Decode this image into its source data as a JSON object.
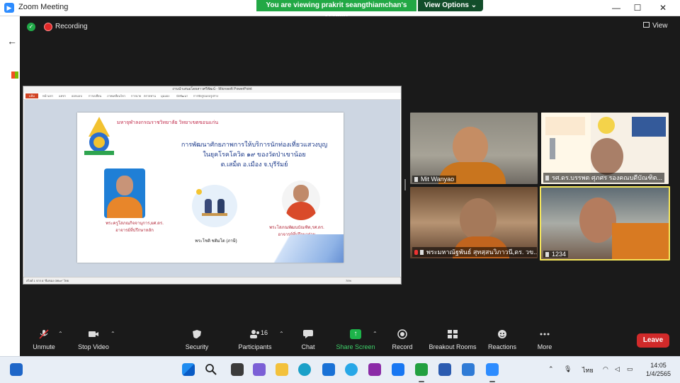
{
  "window": {
    "title": "Zoom Meeting",
    "minimize": "—",
    "maximize": "☐",
    "close": "✕"
  },
  "share_banner": {
    "text": "You are viewing prakrit seangthiamchan's screen",
    "view_options": "View Options ⌄"
  },
  "meeting": {
    "recording_label": "Recording",
    "view_label": "View"
  },
  "ppt": {
    "window_title": "งานนำเสนอโดยสาวศรีพัฒน์ - Microsoft PowerPoint",
    "file_tab": "แฟ้ม",
    "ribbon_tabs": [
      "หน้าแรก",
      "แทรก",
      "ออกแบบ",
      "การเปลี่ยน",
      "ภาพเคลื่อนไหว",
      "การฉาย",
      "ตรวจทาน",
      "มุมมอง",
      "นักพัฒนา",
      "การจัดรูปแบบรูปร่าง"
    ],
    "status_left": "สไลด์ 1 จาก 8   \"ธีมของ Office\"   ไทย",
    "status_zoom": "70%",
    "slide": {
      "header": "มหาจุฬาลงกรณราชวิทยาลัย วิทยาเขตขอนแก่น",
      "title_lines": [
        "การพัฒนาศักยภาพการให้บริการนักท่องเที่ยวแสวงบุญ",
        "ในยุคโรคโควิด ๑๙ ของวัดป่าเขาน้อย",
        "ต.เสม็ด อ.เมือง จ.บุรีรัมย์"
      ],
      "caption_left_lines": [
        "พระครูโสภณกิจจานุการ,ผศ.ดร.",
        "อาจารย์ที่ปรึกษาหลัก"
      ],
      "caption_center": "พระโชติ ชติมโต (ภาษี)",
      "caption_right_lines": [
        "พระโสภณพัฒนบัณฑิต,รศ.ดร.",
        "อาจารย์ที่ปรึกษาร่วม"
      ]
    }
  },
  "participants_tiles": [
    {
      "name": "Mit Wanyao",
      "muted": false
    },
    {
      "name": "รศ.ดร.บรรพต ศุภศร รองคณบดีบัณฑิต...",
      "muted": false
    },
    {
      "name": "พระมหาณัฐพันธ์ สุทสฺสนวิภาวนี,ดร. วข...",
      "muted": true
    },
    {
      "name": "1234",
      "muted": false
    }
  ],
  "toolbar": {
    "unmute": "Unmute",
    "stop_video": "Stop Video",
    "security": "Security",
    "participants": "Participants",
    "participants_count": "16",
    "chat": "Chat",
    "share_screen": "Share Screen",
    "record": "Record",
    "breakout_rooms": "Breakout Rooms",
    "reactions": "Reactions",
    "more": "More",
    "leave": "Leave"
  },
  "taskbar": {
    "language": "ไทย",
    "time": "14:05",
    "date": "1/4/2565"
  },
  "colors": {
    "zoom_bg": "#1a1a1a",
    "share_banner": "#22a845",
    "leave_red": "#d12a2a",
    "active_speaker_border": "#f4e55c"
  }
}
